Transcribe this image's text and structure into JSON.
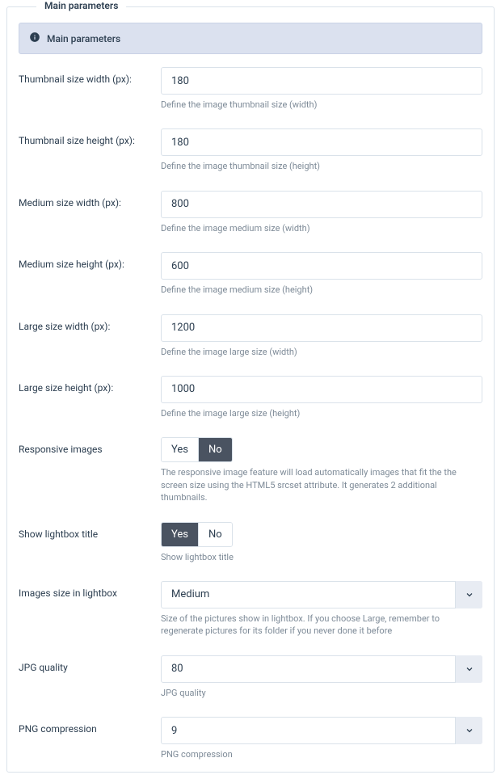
{
  "panel": {
    "legend": "Main parameters",
    "alert_text": "Main parameters"
  },
  "fields": {
    "thumb_w": {
      "label": "Thumbnail size width (px):",
      "value": "180",
      "helper": "Define the image thumbnail size (width)"
    },
    "thumb_h": {
      "label": "Thumbnail size height (px):",
      "value": "180",
      "helper": "Define the image thumbnail size (height)"
    },
    "med_w": {
      "label": "Medium size width (px):",
      "value": "800",
      "helper": "Define the image medium size (width)"
    },
    "med_h": {
      "label": "Medium size height (px):",
      "value": "600",
      "helper": "Define the image medium size (height)"
    },
    "large_w": {
      "label": "Large size width (px):",
      "value": "1200",
      "helper": "Define the image large size (width)"
    },
    "large_h": {
      "label": "Large size height (px):",
      "value": "1000",
      "helper": "Define the image large size (height)"
    },
    "responsive": {
      "label": "Responsive images",
      "yes": "Yes",
      "no": "No",
      "helper": "The responsive image feature will load automatically images that fit the the screen size using the HTML5 srcset attribute. It generates 2 additional thumbnails."
    },
    "lightbox_title": {
      "label": "Show lightbox title",
      "yes": "Yes",
      "no": "No",
      "helper": "Show lightbox title"
    },
    "lightbox_size": {
      "label": "Images size in lightbox",
      "value": "Medium",
      "helper": "Size of the pictures show in lightbox. If you choose Large, remember to regenerate pictures for its folder if you never done it before"
    },
    "jpg": {
      "label": "JPG quality",
      "value": "80",
      "helper": "JPG quality"
    },
    "png": {
      "label": "PNG compression",
      "value": "9",
      "helper": "PNG compression"
    }
  }
}
